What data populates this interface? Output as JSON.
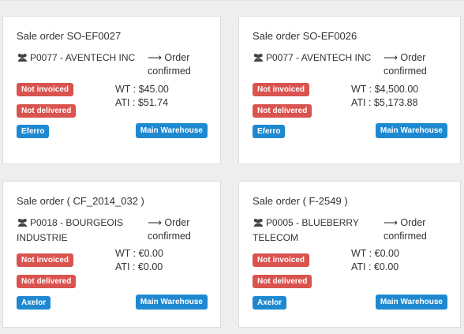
{
  "cards": [
    {
      "title": "Sale order SO-EF0027",
      "partner": "P0077 - AVENTECH INC",
      "status": "Order confirmed",
      "wt": "WT : $45.00",
      "ati": "ATI : $51.74",
      "badges": [
        "Not invoiced",
        "Not delivered"
      ],
      "company": "Eferro",
      "warehouse": "Main Warehouse"
    },
    {
      "title": "Sale order SO-EF0026",
      "partner": "P0077 - AVENTECH INC",
      "status": "Order confirmed",
      "wt": "WT : $4,500.00",
      "ati": "ATI : $5,173.88",
      "badges": [
        "Not invoiced",
        "Not delivered"
      ],
      "company": "Eferro",
      "warehouse": "Main Warehouse"
    },
    {
      "title": "Sale order ( CF_2014_032 )",
      "partner": "P0018 - BOURGEOIS INDUSTRIE",
      "status": "Order confirmed",
      "wt": "WT : €0.00",
      "ati": "ATI : €0.00",
      "badges": [
        "Not invoiced",
        "Not delivered"
      ],
      "company": "Axelor",
      "warehouse": "Main Warehouse"
    },
    {
      "title": "Sale order ( F-2549 )",
      "partner": "P0005 - BLUEBERRY TELECOM",
      "status": "Order confirmed",
      "wt": "WT : €0.00",
      "ati": "ATI : €0.00",
      "badges": [
        "Not invoiced",
        "Not delivered"
      ],
      "company": "Axelor",
      "warehouse": "Main Warehouse"
    }
  ],
  "icons": {
    "partner": "users-icon",
    "status": "arrow-right-icon"
  },
  "colors": {
    "not_invoiced": "#d9534f",
    "not_delivered": "#d9534f",
    "company": "#1e88d0",
    "warehouse": "#1e88d0"
  }
}
